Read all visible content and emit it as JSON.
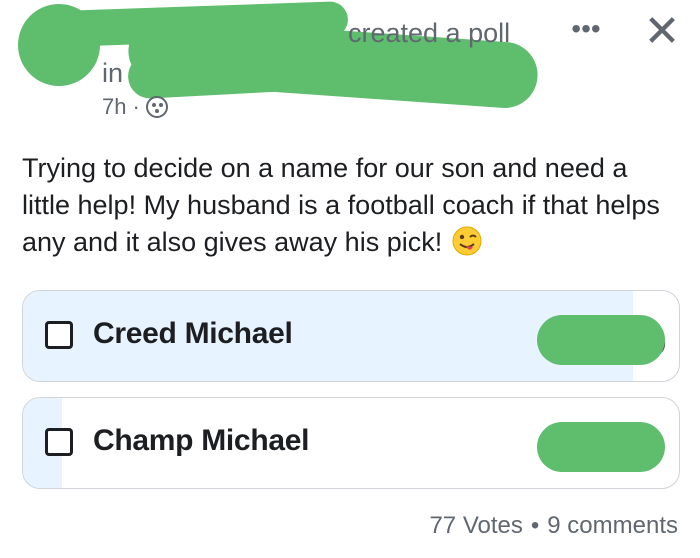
{
  "header": {
    "action_text": "created a poll",
    "group_prefix": "in",
    "timestamp": "7h",
    "separator": "·",
    "audience_icon": "group-icon",
    "more_label": "•••",
    "close_label": "✕"
  },
  "post": {
    "text": "Trying to decide on a name for our son and need a little help! My husband is a football coach if that helps any and it also gives away his pick!",
    "emoji": "winking-face-with-tongue"
  },
  "poll": {
    "options": [
      {
        "label": "Creed Michael",
        "vote_share": 0.93
      },
      {
        "label": "Champ Michael",
        "vote_share": 0.06
      }
    ],
    "fill_color": "#e7f3ff"
  },
  "footer": {
    "votes": "77 Votes",
    "dot": "•",
    "comments": "9 comments"
  },
  "colors": {
    "redaction": "#5fbd6e",
    "secondary_text": "#606770",
    "primary_text": "#1c1e21"
  }
}
